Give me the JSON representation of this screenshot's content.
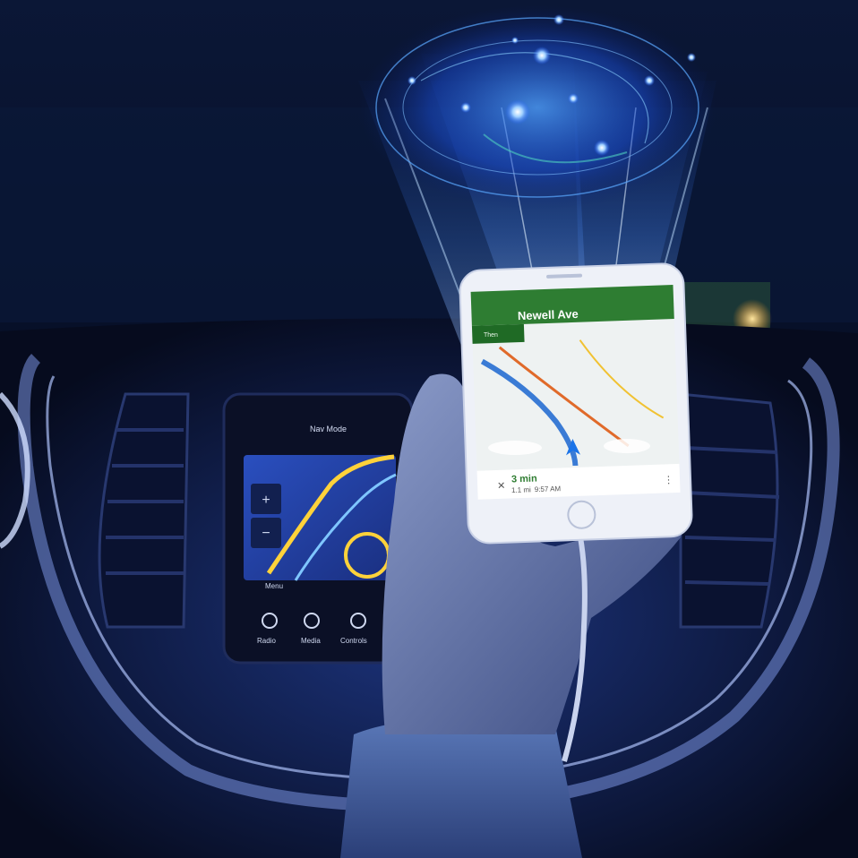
{
  "phone": {
    "street": "Newell Ave",
    "turn_hint": "Then",
    "duration": "3 min",
    "distance": "1.1 mi",
    "arrival": "9:57 AM",
    "nav_green": "#2e7d32"
  },
  "head_unit": {
    "top_label": "Nav Mode",
    "menu_label": "Menu",
    "buttons": [
      "Radio",
      "Media",
      "Controls"
    ]
  },
  "colors": {
    "night_blue": "#0a1a4a",
    "hologram": "#3a8bff",
    "trim_glow": "#6f8bd8"
  }
}
